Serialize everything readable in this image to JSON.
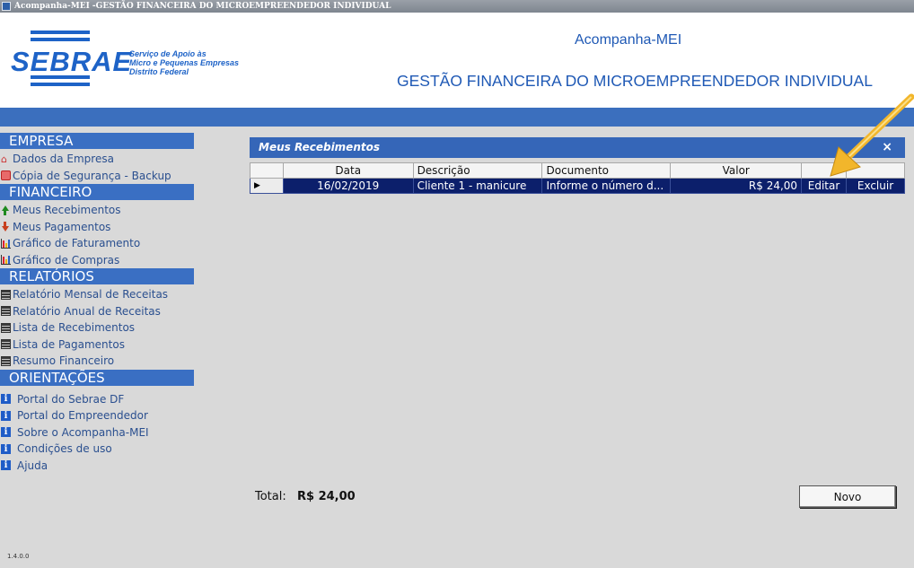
{
  "window": {
    "title": "Acompanha-MEI -GESTÃO FINANCEIRA DO MICROEMPREENDEDOR INDIVIDUAL"
  },
  "header": {
    "logo_text": "SEBRAE",
    "logo_tagline": [
      "Serviço de Apoio às",
      "Micro e Pequenas Empresas",
      "Distrito Federal"
    ],
    "app_name": "Acompanha-MEI",
    "app_subtitle": "GESTÃO FINANCEIRA DO MICROEMPREENDEDOR INDIVIDUAL"
  },
  "sidebar": {
    "sections": [
      {
        "title": "EMPRESA",
        "items": [
          {
            "label": "Dados da Empresa",
            "icon": "house-icon"
          },
          {
            "label": "Cópia de Segurança - Backup",
            "icon": "backup-icon"
          }
        ]
      },
      {
        "title": "FINANCEIRO",
        "items": [
          {
            "label": "Meus Recebimentos",
            "icon": "arrow-up-icon"
          },
          {
            "label": "Meus Pagamentos",
            "icon": "arrow-down-icon"
          },
          {
            "label": "Gráfico de Faturamento",
            "icon": "bar-chart-icon"
          },
          {
            "label": "Gráfico de Compras",
            "icon": "bar-chart-icon"
          }
        ]
      },
      {
        "title": "RELATÓRIOS",
        "items": [
          {
            "label": "Relatório Mensal de Receitas",
            "icon": "report-icon"
          },
          {
            "label": "Relatório Anual de Receitas",
            "icon": "report-icon"
          },
          {
            "label": "Lista de Recebimentos",
            "icon": "report-icon"
          },
          {
            "label": "Lista de Pagamentos",
            "icon": "report-icon"
          },
          {
            "label": "Resumo Financeiro",
            "icon": "report-icon"
          }
        ]
      },
      {
        "title": "ORIENTAÇÕES",
        "items": [
          {
            "label": "Portal do Sebrae DF",
            "icon": "info-icon"
          },
          {
            "label": "Portal do Empreendedor",
            "icon": "info-icon"
          },
          {
            "label": "Sobre o Acompanha-MEI",
            "icon": "info-icon"
          },
          {
            "label": "Condições de uso",
            "icon": "info-icon"
          },
          {
            "label": "Ajuda",
            "icon": "info-icon"
          }
        ]
      }
    ]
  },
  "version": "1.4.0.0",
  "panel": {
    "title": "Meus Recebimentos",
    "close_label": "×",
    "columns": [
      "Data",
      "Descrição",
      "Documento",
      "Valor"
    ],
    "rows": [
      {
        "data": "16/02/2019",
        "descricao": "Cliente 1 - manicure",
        "documento": "Informe o número d...",
        "valor": "R$ 24,00",
        "edit_label": "Editar",
        "delete_label": "Excluir"
      }
    ],
    "total_label": "Total:",
    "total_value": "R$ 24,00",
    "new_button": "Novo"
  },
  "colors": {
    "accent": "#3566b8",
    "brand": "#1e63c7",
    "selected_row": "#0c1f6b",
    "annotation_arrow": "#f2b62b"
  }
}
